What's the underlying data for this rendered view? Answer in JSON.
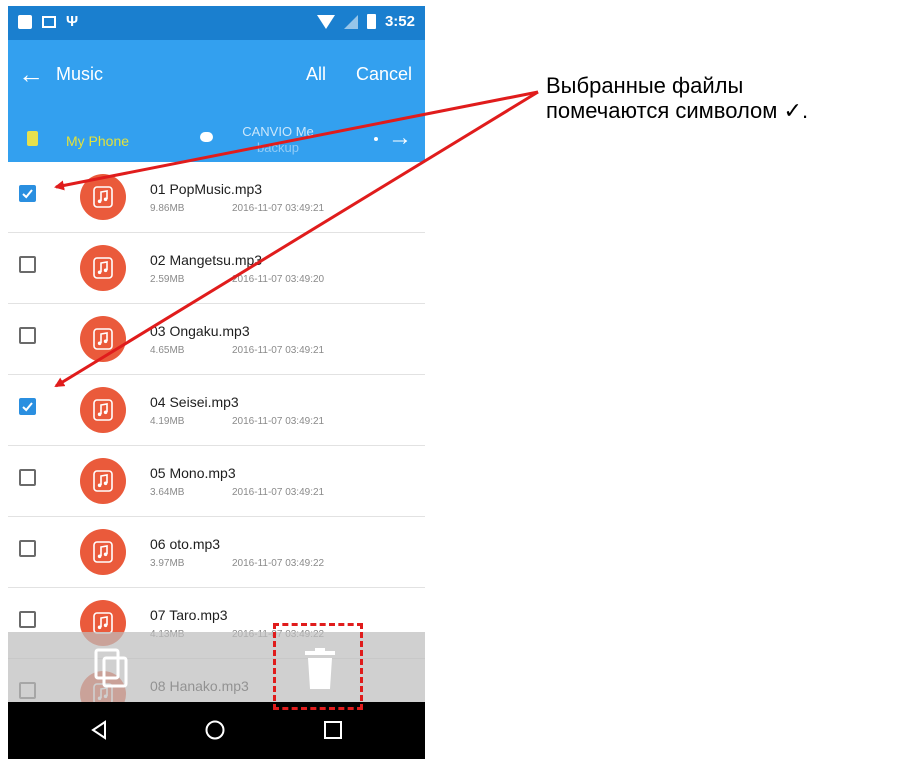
{
  "status_bar": {
    "time": "3:52",
    "icons": [
      "notification-square-icon",
      "image-icon",
      "usb-icon",
      "wifi-icon",
      "signal-icon",
      "battery-icon"
    ]
  },
  "app_bar": {
    "back_icon": "arrow-left-icon",
    "title": "Music",
    "all_label": "All",
    "cancel_label": "Cancel"
  },
  "storage_tabs": [
    {
      "label": "My Phone",
      "active": true
    },
    {
      "label_line1": "CANVIO Me",
      "label_line2": "backup",
      "active": false
    }
  ],
  "files": [
    {
      "name": "01 PopMusic.mp3",
      "size": "9.86MB",
      "date": "2016-11-07 03:49:21",
      "checked": true
    },
    {
      "name": "02 Mangetsu.mp3",
      "size": "2.59MB",
      "date": "2016-11-07 03:49:20",
      "checked": false
    },
    {
      "name": "03 Ongaku.mp3",
      "size": "4.65MB",
      "date": "2016-11-07 03:49:21",
      "checked": false
    },
    {
      "name": "04 Seisei.mp3",
      "size": "4.19MB",
      "date": "2016-11-07 03:49:21",
      "checked": true
    },
    {
      "name": "05 Mono.mp3",
      "size": "3.64MB",
      "date": "2016-11-07 03:49:21",
      "checked": false
    },
    {
      "name": "06 oto.mp3",
      "size": "3.97MB",
      "date": "2016-11-07 03:49:22",
      "checked": false
    },
    {
      "name": "07 Taro.mp3",
      "size": "4.13MB",
      "date": "2016-11-07 03:49:22",
      "checked": false
    },
    {
      "name": "08 Hanako.mp3",
      "size": "",
      "date": "",
      "checked": false
    }
  ],
  "action_bar": {
    "icons": [
      "copy-icon",
      "trash-icon"
    ]
  },
  "nav_bar": {
    "icons": [
      "nav-back-icon",
      "nav-home-icon",
      "nav-recent-icon"
    ]
  },
  "annotation": {
    "line1": "Выбранные файлы",
    "line2": "помечаются символом ✓."
  },
  "colors": {
    "status_bar": "#1a7fcf",
    "app_bar": "#33a0ef",
    "tab_active": "#e4e23a",
    "checkbox_checked": "#2a8fe0",
    "music_icon": "#ea5a3b",
    "annotation_red": "#e01c1c"
  }
}
